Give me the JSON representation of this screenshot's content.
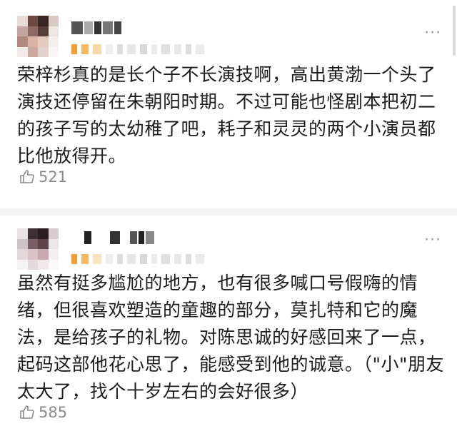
{
  "comments": [
    {
      "text": "荣梓杉真的是长个子不长演技啊，高出黄渤一个头了演技还停留在朱朝阳时期。不过可能也怪剧本把初二的孩子写的太幼稚了吧，耗子和灵灵的两个小演员都比他放得开。",
      "likes": "521",
      "more_label": "···"
    },
    {
      "text": "虽然有挺多尴尬的地方，也有很多喊口号假嗨的情绪，但很喜欢塑造的童趣的部分，莫扎特和它的魔法，是给孩子的礼物。对陈思诚的好感回来了一点，起码这部他花心思了，能感受到他的诚意。（\"小\"朋友太大了，找个十岁左右的会好很多）",
      "likes": "585",
      "more_label": "···"
    }
  ],
  "colors": {
    "text": "#1c1c1c",
    "meta": "#8a8a8a",
    "divider": "#f4f4f4",
    "badge_orange": "#f0a030"
  },
  "icons": {
    "like": "thumbs-up-icon",
    "more": "more-dots-icon"
  }
}
